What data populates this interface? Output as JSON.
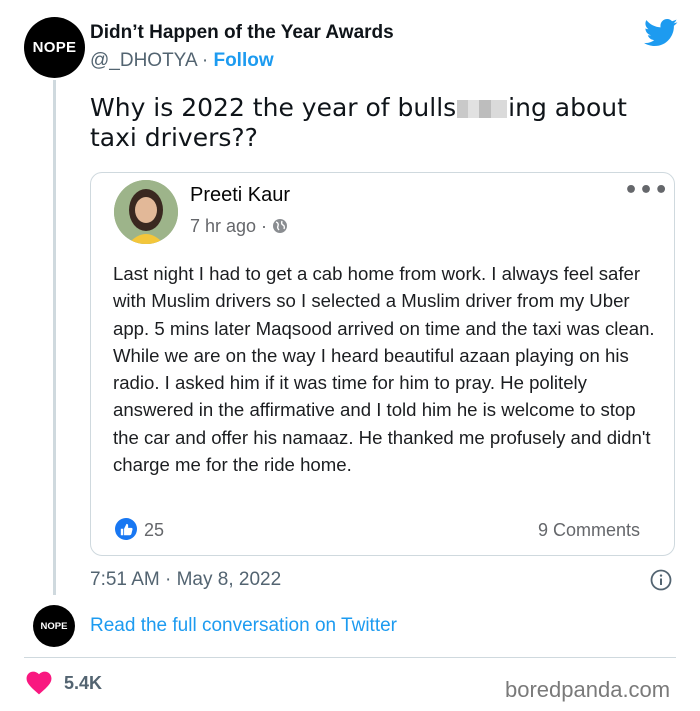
{
  "tweet": {
    "author_name": "Didn’t Happen of the Year Awards",
    "handle": "@_DHOTYA",
    "separator": " · ",
    "follow_label": "Follow",
    "avatar_text": "NOPE",
    "text_part1": "Why is 2022 the year of bulls",
    "text_part2": "ing about taxi drivers??",
    "timestamp": "7:51 AM · May 8, 2022",
    "read_full_label": "Read the full conversation on Twitter",
    "likes": "5.4K"
  },
  "embedded_post": {
    "author": "Preeti Kaur",
    "time": "7 hr ago ·",
    "more_label": "•••",
    "body": "Last night I had to get a cab home from work. I always feel safer with Muslim drivers so I selected a Muslim driver from my Uber app. 5 mins later Maqsood arrived on time and the taxi was clean. While we are on the way I heard beautiful azaan playing on his radio. I asked him if it was time for him to pray. He politely answered in the affirmative and I told him he is welcome to stop the car and offer his namaaz. He thanked me profusely and didn't charge me for the ride home.",
    "like_count": "25",
    "comments": "9 Comments"
  },
  "watermark": "boredpanda.com",
  "colors": {
    "twitter_blue": "#1d9bf0",
    "facebook_blue": "#1877f2",
    "heart_pink": "#f91880"
  },
  "icons": [
    "twitter-bird-icon",
    "globe-icon",
    "thumbs-up-icon",
    "info-icon",
    "heart-icon",
    "more-icon"
  ]
}
